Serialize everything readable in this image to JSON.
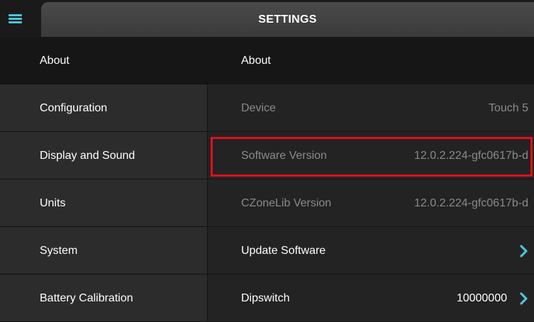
{
  "header": {
    "title": "SETTINGS"
  },
  "icons": {
    "menu": "hamburger-menu-icon",
    "chevron": "chevron-right-icon"
  },
  "colors": {
    "accent": "#4ec3d8",
    "highlight": "#e0101c"
  },
  "sidebar": {
    "items": [
      {
        "label": "About",
        "active": true
      },
      {
        "label": "Configuration"
      },
      {
        "label": "Display and Sound"
      },
      {
        "label": "Units"
      },
      {
        "label": "System"
      },
      {
        "label": "Battery Calibration"
      }
    ]
  },
  "content": {
    "section_title": "About",
    "rows": [
      {
        "label": "Device",
        "value": "Touch 5"
      },
      {
        "label": "Software Version",
        "value": "12.0.2.224-gfc0617b-d"
      },
      {
        "label": "CZoneLib Version",
        "value": "12.0.2.224-gfc0617b-d"
      },
      {
        "label": "Update Software",
        "value": ""
      },
      {
        "label": "Dipswitch",
        "value": "10000000"
      }
    ]
  }
}
